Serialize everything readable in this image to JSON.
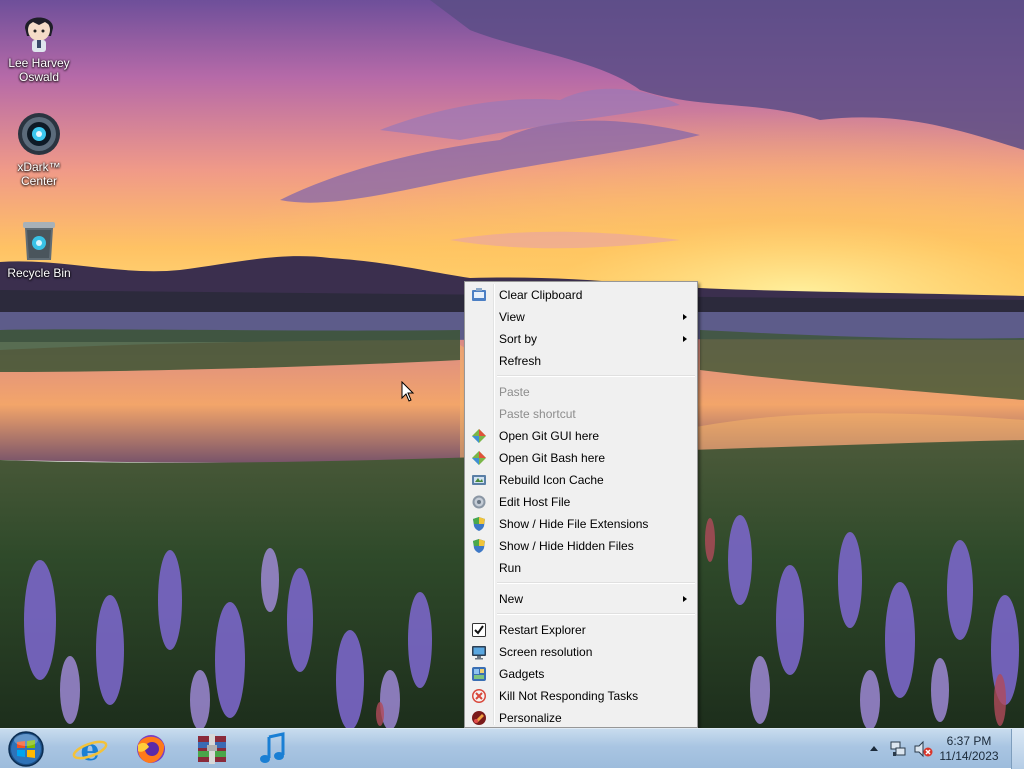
{
  "desktop": {
    "icons": [
      {
        "label": "Lee Harvey Oswald",
        "icon": "anime-avatar-icon"
      },
      {
        "label": "xDark™ Center",
        "icon": "xdark-center-icon"
      },
      {
        "label": "Recycle Bin",
        "icon": "recycle-bin-icon"
      }
    ]
  },
  "context_menu": {
    "items": [
      {
        "label": "Clear Clipboard",
        "icon": "clipboard-icon",
        "enabled": true
      },
      {
        "label": "View",
        "submenu": true,
        "enabled": true
      },
      {
        "label": "Sort by",
        "submenu": true,
        "enabled": true
      },
      {
        "label": "Refresh",
        "enabled": true
      },
      {
        "label": "Paste",
        "enabled": false
      },
      {
        "label": "Paste shortcut",
        "enabled": false
      },
      {
        "label": "Open Git GUI here",
        "icon": "git-icon",
        "enabled": true
      },
      {
        "label": "Open Git Bash here",
        "icon": "git-icon",
        "enabled": true
      },
      {
        "label": "Rebuild Icon Cache",
        "icon": "icon-cache-icon",
        "enabled": true
      },
      {
        "label": "Edit Host File",
        "icon": "gear-icon",
        "enabled": true
      },
      {
        "label": "Show / Hide File Extensions",
        "icon": "shield-icon",
        "enabled": true
      },
      {
        "label": "Show / Hide Hidden Files",
        "icon": "shield-icon",
        "enabled": true
      },
      {
        "label": "Run",
        "enabled": true
      },
      {
        "label": "New",
        "submenu": true,
        "enabled": true
      },
      {
        "label": "Restart Explorer",
        "icon": "checkbox-icon",
        "enabled": true
      },
      {
        "label": "Screen resolution",
        "icon": "monitor-icon",
        "enabled": true
      },
      {
        "label": "Gadgets",
        "icon": "gadgets-icon",
        "enabled": true
      },
      {
        "label": "Kill Not Responding Tasks",
        "icon": "kill-icon",
        "enabled": true
      },
      {
        "label": "Personalize",
        "icon": "personalize-icon",
        "enabled": true
      }
    ]
  },
  "taskbar": {
    "pinned": [
      {
        "icon": "internet-explorer-icon"
      },
      {
        "icon": "firefox-icon"
      },
      {
        "icon": "archive-icon"
      },
      {
        "icon": "music-note-icon"
      }
    ],
    "tray": {
      "icons": [
        "chevron-up-icon",
        "network-icon",
        "volume-muted-icon"
      ]
    },
    "clock": {
      "time": "6:37 PM",
      "date": "11/14/2023"
    }
  },
  "colors": {
    "menu_bg": "#f0f0f0",
    "disabled_text": "#8d8d8d",
    "taskbar_top": "#c8dcee",
    "taskbar_bottom": "#9dbcdc"
  }
}
